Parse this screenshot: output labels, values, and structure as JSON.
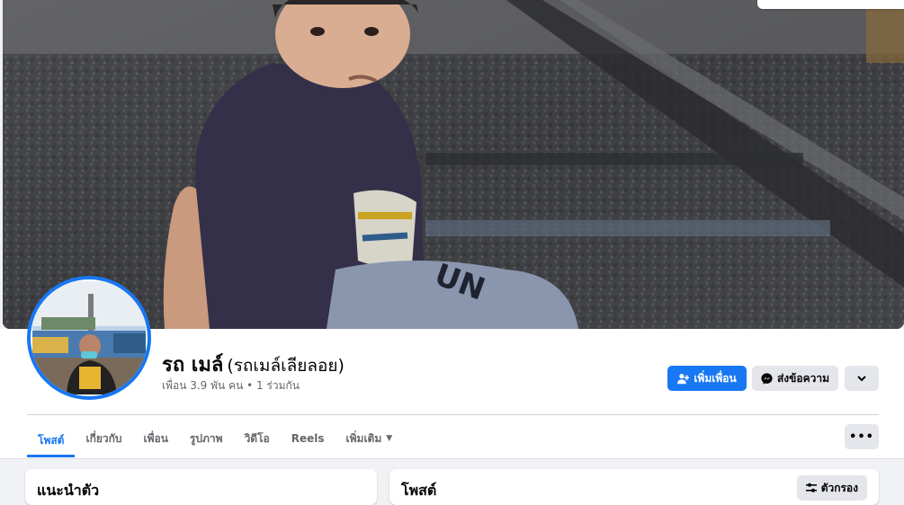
{
  "profile": {
    "name": "รถ เมล์",
    "alt_name": "(รถเมล์เลียลอย)",
    "stats": "เพื่อน 3.9 พัน คน • 1 ร่วมกัน"
  },
  "actions": {
    "add_friend": "เพิ่มเพื่อน",
    "message": "ส่งข้อความ"
  },
  "tabs": [
    {
      "label": "โพสต์"
    },
    {
      "label": "เกี่ยวกับ"
    },
    {
      "label": "เพื่อน"
    },
    {
      "label": "รูปภาพ"
    },
    {
      "label": "วิดีโอ"
    },
    {
      "label": "Reels"
    },
    {
      "label": "เพิ่มเติม"
    }
  ],
  "intro_card": {
    "title": "แนะนำตัว"
  },
  "posts_card": {
    "title": "โพสต์",
    "filter_label": "ตัวกรอง"
  },
  "colors": {
    "accent": "#1877f2",
    "secondary_button": "#e4e6eb",
    "page_bg": "#f0f2f5"
  },
  "icons": [
    "add-friend-icon",
    "messenger-icon",
    "chevron-down-icon",
    "more-dots-icon",
    "filter-icon",
    "caret-down-icon"
  ]
}
